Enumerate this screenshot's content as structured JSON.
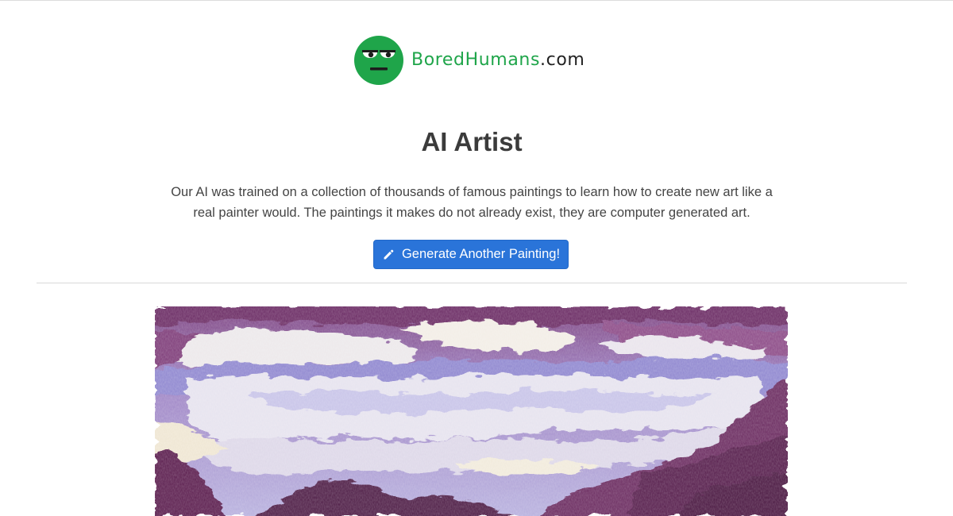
{
  "logo": {
    "brand": "BoredHumans",
    "tld": ".com",
    "icon": "bored-face-icon",
    "colors": {
      "green": "#1fa54a"
    }
  },
  "title": "AI Artist",
  "description": "Our AI was trained on a collection of thousands of famous paintings to learn how to create new art like a real painter would. The paintings it makes do not already exist, they are computer generated art.",
  "generate_button": {
    "label": "Generate Another Painting!",
    "icon": "pencil-icon",
    "color": "#2a74d9"
  },
  "painting": {
    "palette": [
      "#5a1f4e",
      "#8a4a8c",
      "#9f8ccf",
      "#c9c4e6",
      "#efe9e3",
      "#6d6fb8"
    ]
  }
}
